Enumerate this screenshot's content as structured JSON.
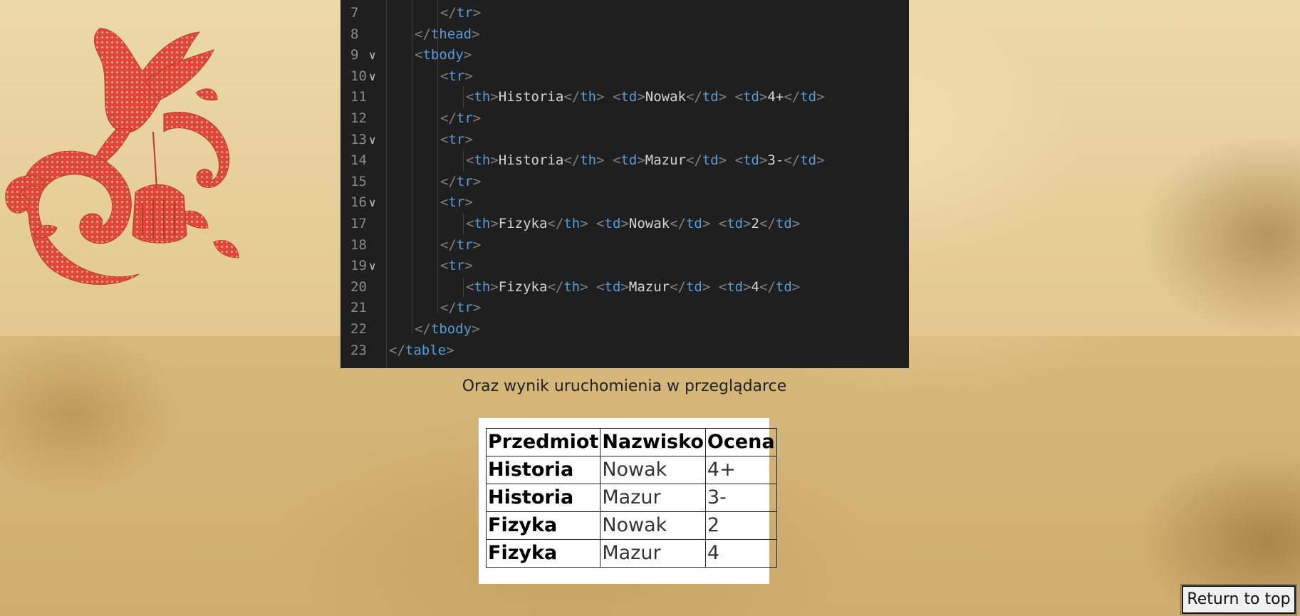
{
  "code_editor": {
    "lines": [
      {
        "num": "7",
        "fold": false,
        "indent": 3,
        "tokens": [
          [
            "punc",
            "</"
          ],
          [
            "tagc",
            "tr"
          ],
          [
            "punc",
            ">"
          ]
        ]
      },
      {
        "num": "8",
        "fold": false,
        "indent": 2,
        "tokens": [
          [
            "punc",
            "</"
          ],
          [
            "tagc",
            "thead"
          ],
          [
            "punc",
            ">"
          ]
        ]
      },
      {
        "num": "9",
        "fold": true,
        "indent": 2,
        "tokens": [
          [
            "punc",
            "<"
          ],
          [
            "tagc",
            "tbody"
          ],
          [
            "punc",
            ">"
          ]
        ]
      },
      {
        "num": "10",
        "fold": true,
        "indent": 3,
        "tokens": [
          [
            "punc",
            "<"
          ],
          [
            "tagc",
            "tr"
          ],
          [
            "punc",
            ">"
          ]
        ]
      },
      {
        "num": "11",
        "fold": false,
        "indent": 4,
        "tokens": [
          [
            "punc",
            "<"
          ],
          [
            "tagc",
            "th"
          ],
          [
            "punc",
            ">"
          ],
          [
            "txt",
            "Historia"
          ],
          [
            "punc",
            "</"
          ],
          [
            "tagc",
            "th"
          ],
          [
            "punc",
            "> <"
          ],
          [
            "tagc",
            "td"
          ],
          [
            "punc",
            ">"
          ],
          [
            "txt",
            "Nowak"
          ],
          [
            "punc",
            "</"
          ],
          [
            "tagc",
            "td"
          ],
          [
            "punc",
            "> <"
          ],
          [
            "tagc",
            "td"
          ],
          [
            "punc",
            ">"
          ],
          [
            "txt",
            "4+"
          ],
          [
            "punc",
            "</"
          ],
          [
            "tagc",
            "td"
          ],
          [
            "punc",
            ">"
          ]
        ]
      },
      {
        "num": "12",
        "fold": false,
        "indent": 3,
        "tokens": [
          [
            "punc",
            "</"
          ],
          [
            "tagc",
            "tr"
          ],
          [
            "punc",
            ">"
          ]
        ]
      },
      {
        "num": "13",
        "fold": true,
        "indent": 3,
        "tokens": [
          [
            "punc",
            "<"
          ],
          [
            "tagc",
            "tr"
          ],
          [
            "punc",
            ">"
          ]
        ]
      },
      {
        "num": "14",
        "fold": false,
        "indent": 4,
        "tokens": [
          [
            "punc",
            "<"
          ],
          [
            "tagc",
            "th"
          ],
          [
            "punc",
            ">"
          ],
          [
            "txt",
            "Historia"
          ],
          [
            "punc",
            "</"
          ],
          [
            "tagc",
            "th"
          ],
          [
            "punc",
            "> <"
          ],
          [
            "tagc",
            "td"
          ],
          [
            "punc",
            ">"
          ],
          [
            "txt",
            "Mazur"
          ],
          [
            "punc",
            "</"
          ],
          [
            "tagc",
            "td"
          ],
          [
            "punc",
            "> <"
          ],
          [
            "tagc",
            "td"
          ],
          [
            "punc",
            ">"
          ],
          [
            "txt",
            "3-"
          ],
          [
            "punc",
            "</"
          ],
          [
            "tagc",
            "td"
          ],
          [
            "punc",
            ">"
          ]
        ]
      },
      {
        "num": "15",
        "fold": false,
        "indent": 3,
        "tokens": [
          [
            "punc",
            "</"
          ],
          [
            "tagc",
            "tr"
          ],
          [
            "punc",
            ">"
          ]
        ]
      },
      {
        "num": "16",
        "fold": true,
        "indent": 3,
        "tokens": [
          [
            "punc",
            "<"
          ],
          [
            "tagc",
            "tr"
          ],
          [
            "punc",
            ">"
          ]
        ]
      },
      {
        "num": "17",
        "fold": false,
        "indent": 4,
        "tokens": [
          [
            "punc",
            "<"
          ],
          [
            "tagc",
            "th"
          ],
          [
            "punc",
            ">"
          ],
          [
            "txt",
            "Fizyka"
          ],
          [
            "punc",
            "</"
          ],
          [
            "tagc",
            "th"
          ],
          [
            "punc",
            "> <"
          ],
          [
            "tagc",
            "td"
          ],
          [
            "punc",
            ">"
          ],
          [
            "txt",
            "Nowak"
          ],
          [
            "punc",
            "</"
          ],
          [
            "tagc",
            "td"
          ],
          [
            "punc",
            "> <"
          ],
          [
            "tagc",
            "td"
          ],
          [
            "punc",
            ">"
          ],
          [
            "txt",
            "2"
          ],
          [
            "punc",
            "</"
          ],
          [
            "tagc",
            "td"
          ],
          [
            "punc",
            ">"
          ]
        ]
      },
      {
        "num": "18",
        "fold": false,
        "indent": 3,
        "tokens": [
          [
            "punc",
            "</"
          ],
          [
            "tagc",
            "tr"
          ],
          [
            "punc",
            ">"
          ]
        ]
      },
      {
        "num": "19",
        "fold": true,
        "indent": 3,
        "tokens": [
          [
            "punc",
            "<"
          ],
          [
            "tagc",
            "tr"
          ],
          [
            "punc",
            ">"
          ]
        ]
      },
      {
        "num": "20",
        "fold": false,
        "indent": 4,
        "tokens": [
          [
            "punc",
            "<"
          ],
          [
            "tagc",
            "th"
          ],
          [
            "punc",
            ">"
          ],
          [
            "txt",
            "Fizyka"
          ],
          [
            "punc",
            "</"
          ],
          [
            "tagc",
            "th"
          ],
          [
            "punc",
            "> <"
          ],
          [
            "tagc",
            "td"
          ],
          [
            "punc",
            ">"
          ],
          [
            "txt",
            "Mazur"
          ],
          [
            "punc",
            "</"
          ],
          [
            "tagc",
            "td"
          ],
          [
            "punc",
            "> <"
          ],
          [
            "tagc",
            "td"
          ],
          [
            "punc",
            ">"
          ],
          [
            "txt",
            "4"
          ],
          [
            "punc",
            "</"
          ],
          [
            "tagc",
            "td"
          ],
          [
            "punc",
            ">"
          ]
        ]
      },
      {
        "num": "21",
        "fold": false,
        "indent": 3,
        "tokens": [
          [
            "punc",
            "</"
          ],
          [
            "tagc",
            "tr"
          ],
          [
            "punc",
            ">"
          ]
        ]
      },
      {
        "num": "22",
        "fold": false,
        "indent": 2,
        "tokens": [
          [
            "punc",
            "</"
          ],
          [
            "tagc",
            "tbody"
          ],
          [
            "punc",
            ">"
          ]
        ]
      },
      {
        "num": "23",
        "fold": false,
        "indent": 1,
        "tokens": [
          [
            "punc",
            "</"
          ],
          [
            "tagc",
            "table"
          ],
          [
            "punc",
            ">"
          ]
        ]
      }
    ]
  },
  "caption": "Oraz wynik uruchomienia w przeglądarce",
  "result_table": {
    "headers": [
      "Przedmiot",
      "Nazwisko",
      "Ocena"
    ],
    "rows": [
      [
        "Historia",
        "Nowak",
        "4+"
      ],
      [
        "Historia",
        "Mazur",
        "3-"
      ],
      [
        "Fizyka",
        "Nowak",
        "2"
      ],
      [
        "Fizyka",
        "Mazur",
        "4"
      ]
    ]
  },
  "return_button": {
    "label": "Return to top"
  },
  "colors": {
    "editor_bg": "#1f1f1f",
    "tag": "#569cd6",
    "bracket": "#808080",
    "text": "#d4d4d4",
    "decor_red": "#e0463a"
  },
  "icons": {
    "decoration": "bird-birdcage-ornament-icon",
    "fold": "chevron-down-icon"
  }
}
